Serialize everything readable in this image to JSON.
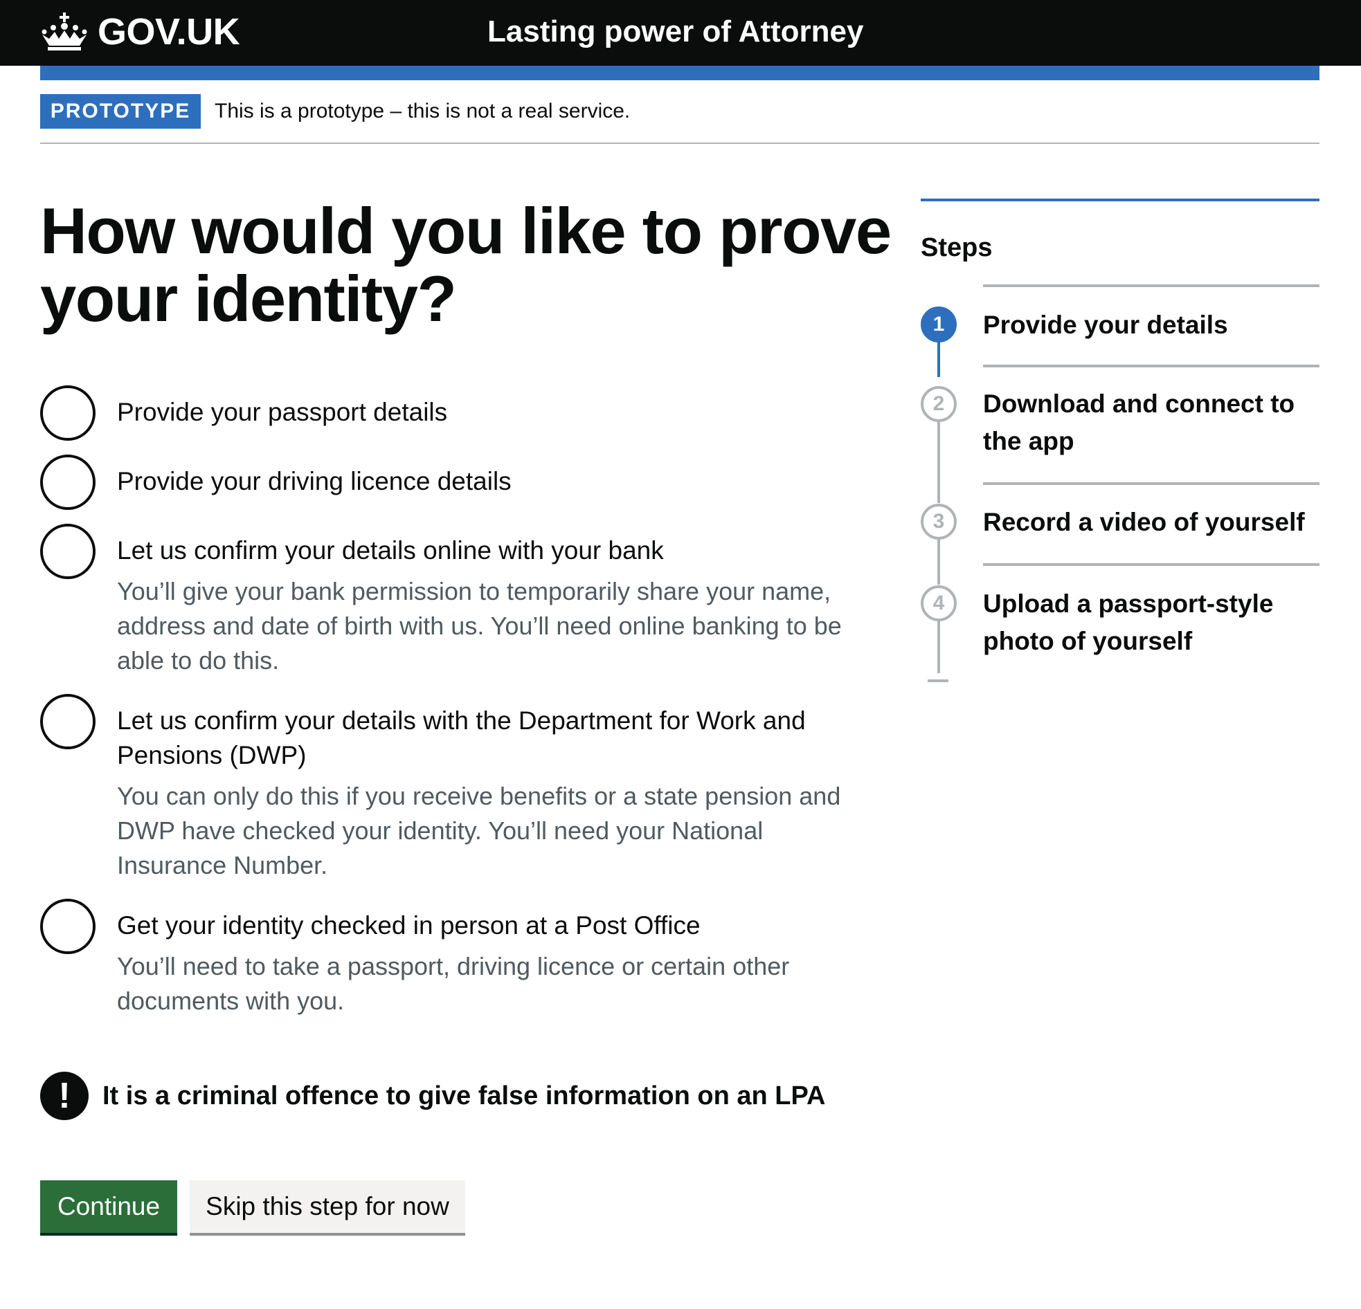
{
  "header": {
    "logo_text": "GOV.UK",
    "service_name": "Lasting power of Attorney"
  },
  "phase_banner": {
    "tag": "PROTOTYPE",
    "text": "This is a prototype – this is not a real service."
  },
  "page_title": "How would you like to prove your identity?",
  "options": [
    {
      "label": "Provide your passport details",
      "hint": ""
    },
    {
      "label": "Provide your driving licence details",
      "hint": ""
    },
    {
      "label": "Let us confirm your details online with your bank",
      "hint": "You’ll give your bank permission to temporarily share your name, address and date of birth with us. You’ll need online banking to be able to do this."
    },
    {
      "label": "Let us confirm your details with the Department for Work and Pensions (DWP)",
      "hint": "You can only do this if you receive benefits or a state pension and DWP have checked your identity. You’ll need your National Insurance Number."
    },
    {
      "label": "Get your identity checked in person at a Post Office",
      "hint": "You’ll need to take a passport, driving licence or certain other documents with you."
    }
  ],
  "warning": {
    "icon": "!",
    "text": "It is a criminal offence to give false information on an LPA"
  },
  "buttons": {
    "continue": "Continue",
    "skip": "Skip this step for now"
  },
  "steps": {
    "title": "Steps",
    "items": [
      {
        "number": "1",
        "label": "Provide your details",
        "active": true
      },
      {
        "number": "2",
        "label": "Download and connect to the app",
        "active": false
      },
      {
        "number": "3",
        "label": "Record a video of yourself",
        "active": false
      },
      {
        "number": "4",
        "label": "Upload a passport-style photo of yourself",
        "active": false
      }
    ]
  },
  "colors": {
    "header_bg": "#0b0c0c",
    "brand_blue": "#2d6fbd",
    "button_green": "#2b6e3a",
    "hint_grey": "#505a5f",
    "border_grey": "#b1b4b6"
  }
}
